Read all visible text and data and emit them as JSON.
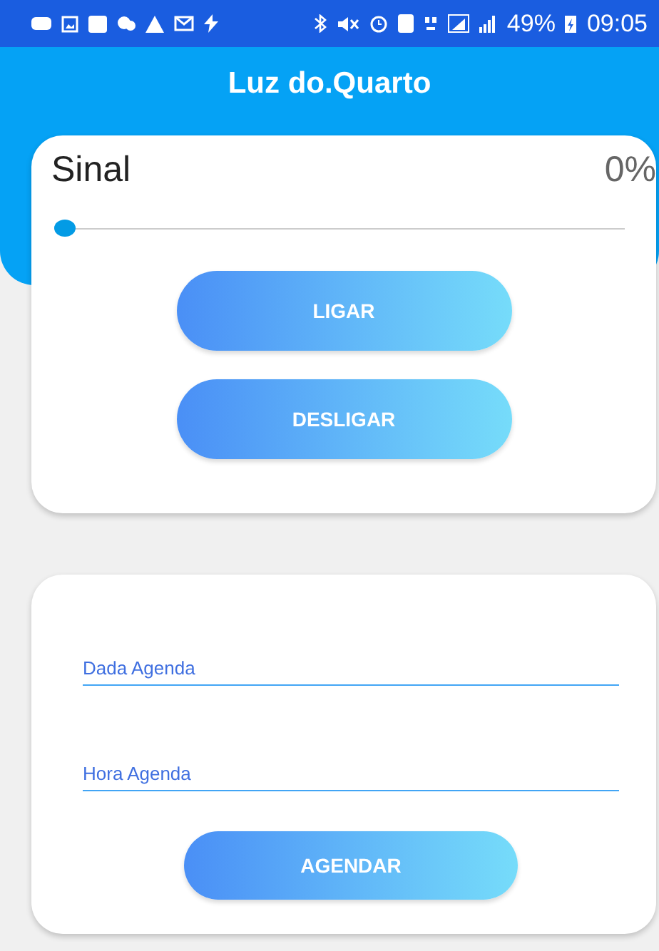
{
  "status_bar": {
    "battery": "49%",
    "time": "09:05"
  },
  "title": "Luz do.Quarto",
  "signal": {
    "label": "Sinal",
    "reading": "0%",
    "level": 0
  },
  "buttons": [
    "LIGAR",
    "DESLIGAR"
  ],
  "schedule": {
    "fields": [
      {
        "placeholder": "Dada Agenda"
      },
      {
        "placeholder": "Hora Agenda"
      }
    ],
    "button": "AGENDAR"
  }
}
